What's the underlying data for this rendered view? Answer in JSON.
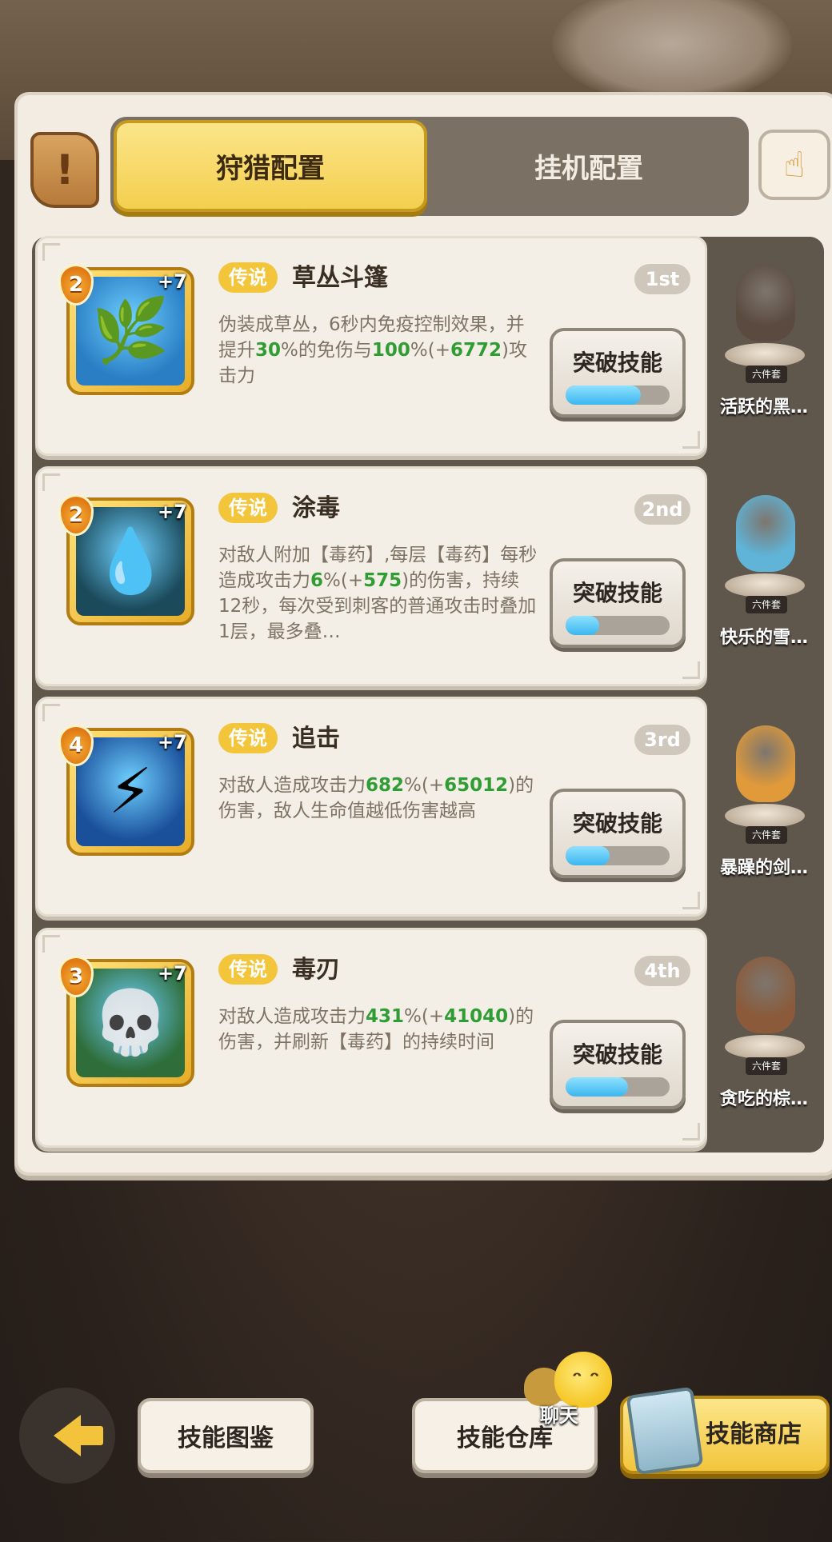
{
  "tabs": {
    "active": "狩猎配置",
    "inactive": "挂机配置"
  },
  "skills": [
    {
      "level": "2",
      "plus": "+7",
      "rarity": "传说",
      "name": "草丛斗篷",
      "rank": "1st",
      "desc": [
        {
          "t": "伪装成草丛，6秒内免疫控制效果，并提升",
          "g": false
        },
        {
          "t": "30",
          "g": true
        },
        {
          "t": "%的免伤与",
          "g": false
        },
        {
          "t": "100",
          "g": true
        },
        {
          "t": "%(+",
          "g": false
        },
        {
          "t": "6772",
          "g": true
        },
        {
          "t": ")攻击力",
          "g": false
        }
      ],
      "button": "突破技能",
      "progress": 0.72,
      "icon_name": "grass-cloak-icon",
      "icon_color": "#2a7ec4",
      "companion": {
        "name": "活跃的黑…",
        "set": "六件套",
        "color": "#5a4a3f"
      }
    },
    {
      "level": "2",
      "plus": "+7",
      "rarity": "传说",
      "name": "涂毒",
      "rank": "2nd",
      "desc": [
        {
          "t": "对敌人附加【毒药】,每层【毒药】每秒造成攻击力",
          "g": false
        },
        {
          "t": "6",
          "g": true
        },
        {
          "t": "%(+",
          "g": false
        },
        {
          "t": "575",
          "g": true
        },
        {
          "t": ")的伤害，持续12秒，每次受到刺客的普通攻击时叠加1层，最多叠…",
          "g": false
        }
      ],
      "button": "突破技能",
      "progress": 0.32,
      "icon_name": "poison-drop-icon",
      "icon_color": "#1b4a5a",
      "companion": {
        "name": "快乐的雪…",
        "set": "六件套",
        "color": "#5fb4d8"
      }
    },
    {
      "level": "4",
      "plus": "+7",
      "rarity": "传说",
      "name": "追击",
      "rank": "3rd",
      "desc": [
        {
          "t": "对敌人造成攻击力",
          "g": false
        },
        {
          "t": "682",
          "g": true
        },
        {
          "t": "%(+",
          "g": false
        },
        {
          "t": "65012",
          "g": true
        },
        {
          "t": ")的伤害，敌人生命值越低伤害越高",
          "g": false
        }
      ],
      "button": "突破技能",
      "progress": 0.42,
      "icon_name": "pursuit-icon",
      "icon_color": "#1a4f9a",
      "companion": {
        "name": "暴躁的剑…",
        "set": "六件套",
        "color": "#e09a3a"
      }
    },
    {
      "level": "3",
      "plus": "+7",
      "rarity": "传说",
      "name": "毒刃",
      "rank": "4th",
      "desc": [
        {
          "t": "对敌人造成攻击力",
          "g": false
        },
        {
          "t": "431",
          "g": true
        },
        {
          "t": "%(+",
          "g": false
        },
        {
          "t": "41040",
          "g": true
        },
        {
          "t": ")的伤害，并刷新【毒药】的持续时间",
          "g": false
        }
      ],
      "button": "突破技能",
      "progress": 0.6,
      "icon_name": "poison-skull-icon",
      "icon_color": "#2f6e3a",
      "companion": {
        "name": "贪吃的棕…",
        "set": "六件套",
        "color": "#8a5a3a"
      }
    }
  ],
  "bottom": {
    "codex": "技能图鉴",
    "warehouse": "技能仓库",
    "shop": "技能商店",
    "chat": "聊天"
  }
}
